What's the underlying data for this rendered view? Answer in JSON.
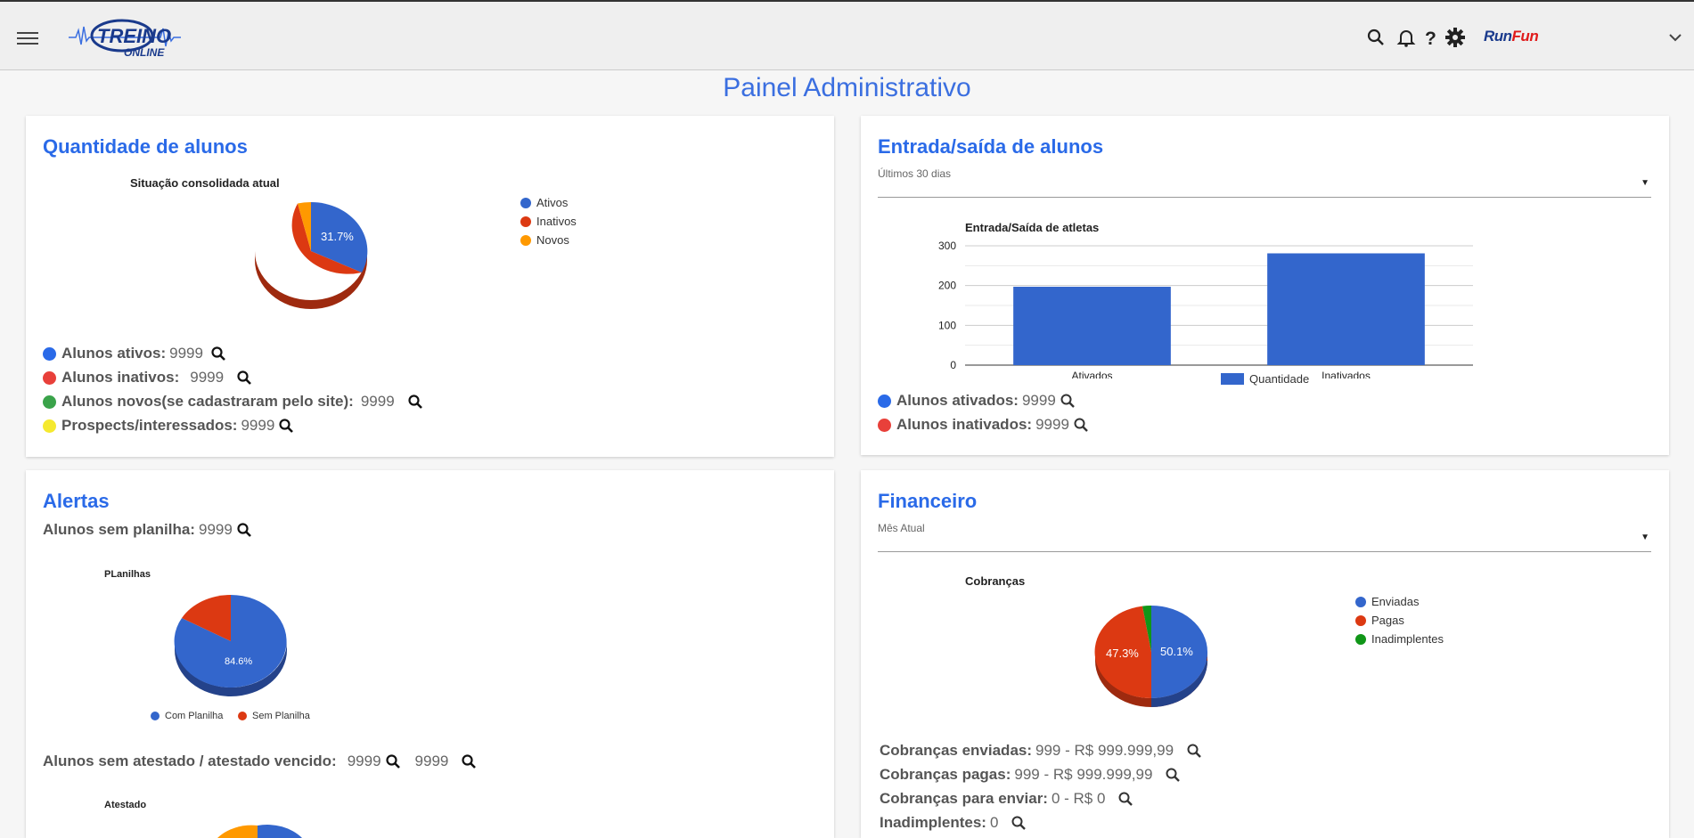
{
  "header": {
    "logo_text_top": "TREINO",
    "logo_text_bottom": "ONLINE",
    "brand_run": "Run",
    "brand_fun": "Fun"
  },
  "page_title": "Painel Administrativo",
  "colors": {
    "blue": "#3366cc",
    "red": "#dc3912",
    "orange": "#ff9900",
    "green": "#109618",
    "accent": "#2a6ae8"
  },
  "card_alunos": {
    "title": "Quantidade de alunos",
    "stats": [
      {
        "label": "Alunos ativos:",
        "value": "9999",
        "dot": "#2a6ae8"
      },
      {
        "label": "Alunos inativos:",
        "value": "9999",
        "dot": "#e8403a"
      },
      {
        "label": "Alunos novos(se cadastraram pelo site):",
        "value": "9999",
        "dot": "#3aa34a"
      },
      {
        "label": "Prospects/interessados:",
        "value": "9999",
        "dot": "#f5e92f"
      }
    ]
  },
  "card_entrada": {
    "title": "Entrada/saída de alunos",
    "period": "Últimos 30 dias",
    "stats": [
      {
        "label": "Alunos ativados:",
        "value": "9999",
        "dot": "#2a6ae8"
      },
      {
        "label": "Alunos inativados:",
        "value": "9999",
        "dot": "#e8403a"
      }
    ]
  },
  "card_alertas": {
    "title": "Alertas",
    "sem_planilha_label": "Alunos sem planilha:",
    "sem_planilha_value": "9999",
    "sem_atestado_label": "Alunos sem atestado / atestado vencido:",
    "sem_atestado_value1": "9999",
    "sem_atestado_value2": "9999",
    "atestado_chart_title": "Atestado"
  },
  "card_financeiro": {
    "title": "Financeiro",
    "period": "Mês Atual",
    "stats": [
      {
        "label": "Cobranças enviadas:",
        "value": "999 - R$ 999.999,99"
      },
      {
        "label": "Cobranças pagas:",
        "value": "999 - R$ 999.999,99"
      },
      {
        "label": "Cobranças para enviar:",
        "value": "0 - R$ 0"
      },
      {
        "label": "Inadimplentes:",
        "value": "0"
      }
    ]
  },
  "chart_data": [
    {
      "type": "pie",
      "title": "Situação consolidada atual",
      "labels": [
        "Ativos",
        "Inativos",
        "Novos"
      ],
      "values": [
        31.7,
        64.3,
        4.0
      ],
      "data_labels": [
        "31.7%",
        "64.3%",
        ""
      ],
      "colors": [
        "#3366cc",
        "#dc3912",
        "#ff9900"
      ],
      "legend": "right"
    },
    {
      "type": "bar",
      "title": "Entrada/Saída de atletas",
      "categories": [
        "Ativados",
        "Inativados"
      ],
      "series": [
        {
          "name": "Quantidade",
          "values": [
            197,
            281
          ]
        }
      ],
      "ylim": [
        0,
        300
      ],
      "yticks": [
        "0",
        "100",
        "200",
        "300"
      ],
      "legend": "bottom"
    },
    {
      "type": "pie",
      "title": "PLanilhas",
      "labels": [
        "Com Planilha",
        "Sem Planilha"
      ],
      "values": [
        84.6,
        15.4
      ],
      "data_labels": [
        "84.6%",
        ""
      ],
      "colors": [
        "#3366cc",
        "#dc3912"
      ],
      "legend": "bottom"
    },
    {
      "type": "pie",
      "title": "Cobranças",
      "labels": [
        "Enviadas",
        "Pagas",
        "Inadimplentes"
      ],
      "values": [
        50.1,
        47.3,
        2.6
      ],
      "data_labels": [
        "50.1%",
        "47.3%",
        ""
      ],
      "colors": [
        "#3366cc",
        "#dc3912",
        "#109618"
      ],
      "legend": "right"
    }
  ]
}
